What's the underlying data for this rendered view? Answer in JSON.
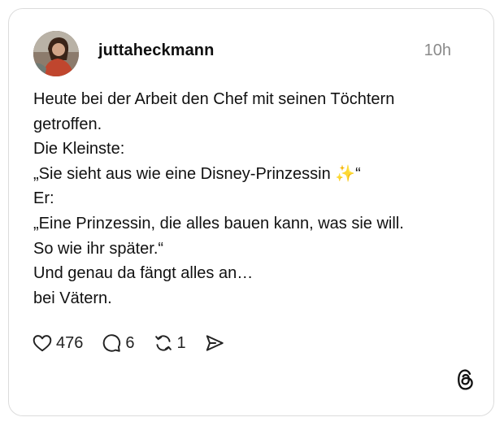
{
  "post": {
    "username": "juttaheckmann",
    "timestamp": "10h",
    "lines": [
      "Heute bei der Arbeit den Chef mit seinen Töchtern",
      "getroffen.",
      "Die Kleinste:",
      "„Sie sieht aus wie eine Disney-Prinzessin ✨“",
      "Er:",
      "„Eine Prinzessin, die alles bauen kann, was sie will.",
      "So wie ihr später.“",
      "Und genau da fängt alles an…",
      "bei Vätern."
    ]
  },
  "actions": {
    "likes": "476",
    "replies": "6",
    "reposts": "1"
  },
  "icons": {
    "like": "heart-icon",
    "reply": "comment-bubble-icon",
    "repost": "repost-icon",
    "share": "send-icon",
    "logo": "threads-logo-icon"
  },
  "colors": {
    "text": "#101010",
    "muted": "#8a8a8a",
    "border": "#dcdcdc"
  }
}
